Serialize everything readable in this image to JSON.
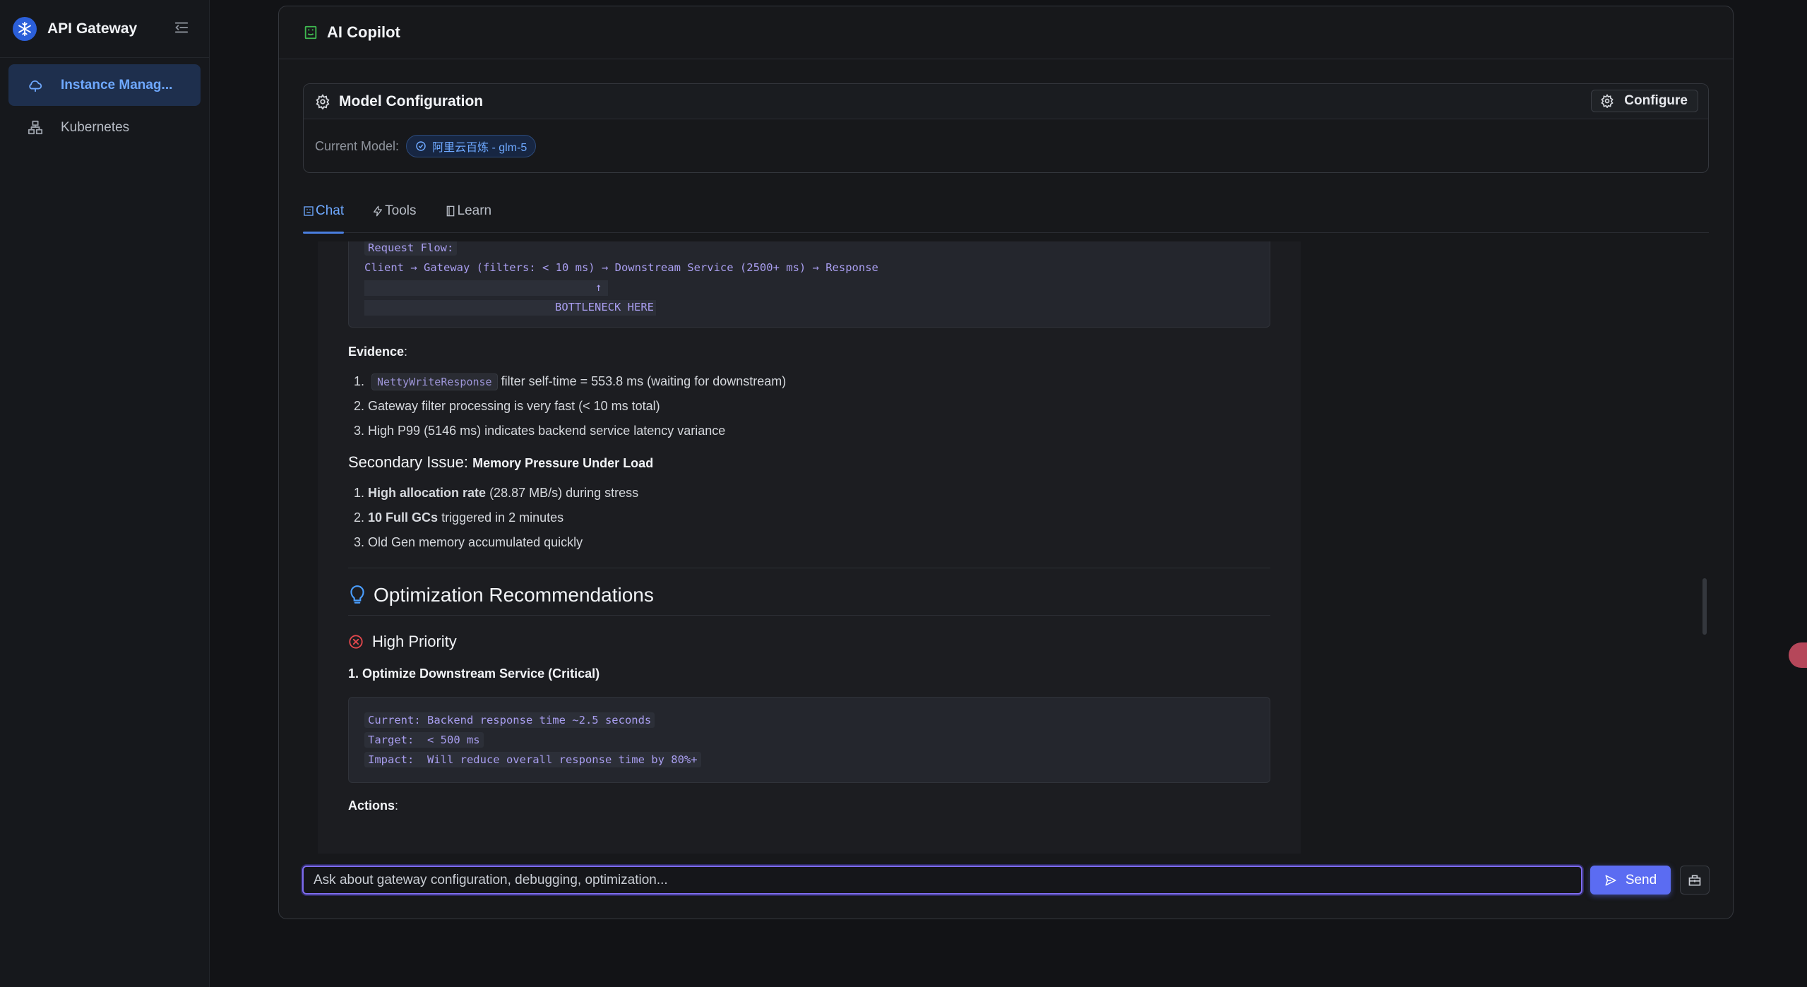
{
  "brand": {
    "title": "API Gateway",
    "logo_icon": "snowflake-icon",
    "accent": "#2b5fd9"
  },
  "sidebar": {
    "items": [
      {
        "label": "Instance Manag...",
        "icon": "cloud-icon",
        "active": true
      },
      {
        "label": "Kubernetes",
        "icon": "cluster-icon",
        "active": false
      }
    ]
  },
  "panel": {
    "title": "AI Copilot",
    "icon": "bot-icon"
  },
  "model_config": {
    "title": "Model Configuration",
    "configure_label": "Configure",
    "current_model_label": "Current Model:",
    "current_model_value": "阿里云百炼 - glm-5"
  },
  "tabs": [
    {
      "label": "Chat",
      "icon": "chat-icon",
      "active": true
    },
    {
      "label": "Tools",
      "icon": "bolt-icon",
      "active": false
    },
    {
      "label": "Learn",
      "icon": "book-icon",
      "active": false
    }
  ],
  "chat": {
    "flow_block": {
      "line1": "Request Flow:",
      "line2": "Client → Gateway (filters: < 10 ms) → Downstream Service (2500+ ms) → Response",
      "line3": "↑",
      "line4": "BOTTLENECK HERE"
    },
    "evidence_label": "Evidence",
    "evidence_colon": ":",
    "evidence": {
      "item1_code": "NettyWriteResponse",
      "item1_text": "filter self-time = 553.8 ms (waiting for downstream)",
      "item2": "Gateway filter processing is very fast (< 10 ms total)",
      "item3": "High P99 (5146 ms) indicates backend service latency variance"
    },
    "secondary": {
      "title": "Secondary Issue:",
      "subtitle": "Memory Pressure Under Load",
      "item1_bold": "High allocation rate",
      "item1_text": "(28.87 MB/s) during stress",
      "item2_bold": "10 Full GCs",
      "item2_text": "triggered in 2 minutes",
      "item3": "Old Gen memory accumulated quickly"
    },
    "optimization_title": "Optimization Recommendations",
    "high_priority_title": "High Priority",
    "rec1_title": "1. Optimize Downstream Service (Critical)",
    "rec1_block": {
      "line1": "Current: Backend response time ~2.5 seconds",
      "line2": "Target:  < 500 ms",
      "line3": "Impact:  Will reduce overall response time by 80%+"
    },
    "actions_label": "Actions",
    "actions_colon": ":"
  },
  "input": {
    "placeholder": "Ask about gateway configuration, debugging, optimization...",
    "send_label": "Send"
  },
  "colors": {
    "accent_blue": "#6ea8ff",
    "send_button": "#5b6cf2",
    "input_border": "#7f6cf0",
    "code_text": "#a99ef0",
    "error_red": "#e5484d",
    "bulb_blue": "#4a9eff"
  }
}
